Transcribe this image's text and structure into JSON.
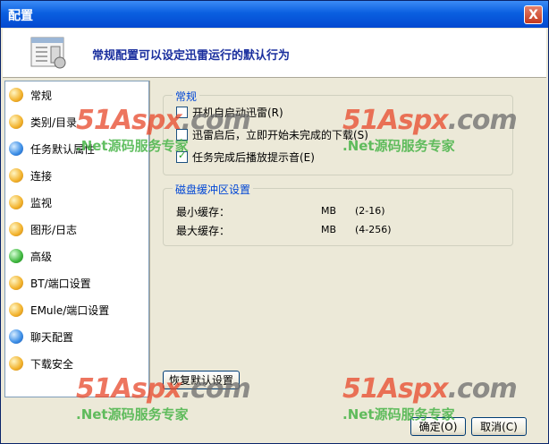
{
  "window": {
    "title": "配置",
    "close_glyph": "X"
  },
  "header": {
    "text": "常规配置可以设定迅雷运行的默认行为",
    "icon": "settings-document-icon"
  },
  "sidebar": {
    "items": [
      {
        "label": "常规",
        "icon": "orange-circle-icon"
      },
      {
        "label": "类别/目录",
        "icon": "orange-circle-icon"
      },
      {
        "label": "任务默认属性",
        "icon": "blue-star-icon"
      },
      {
        "label": "连接",
        "icon": "orange-circle-icon"
      },
      {
        "label": "监视",
        "icon": "orange-circle-icon"
      },
      {
        "label": "图形/日志",
        "icon": "orange-circle-icon"
      },
      {
        "label": "高级",
        "icon": "green-circle-icon"
      },
      {
        "label": "BT/端口设置",
        "icon": "orange-circle-icon"
      },
      {
        "label": "EMule/端口设置",
        "icon": "orange-circle-icon"
      },
      {
        "label": "聊天配置",
        "icon": "chat-icon"
      },
      {
        "label": "下载安全",
        "icon": "orange-circle-icon"
      }
    ]
  },
  "general": {
    "title": "常规",
    "options": [
      {
        "label": "开机自启动迅雷(R)",
        "checked": false
      },
      {
        "label": "迅雷启后，立即开始未完成的下载(S)",
        "checked": false
      },
      {
        "label": "任务完成后播放提示音(E)",
        "checked": true
      }
    ]
  },
  "cache": {
    "title": "磁盘缓冲区设置",
    "min_label": "最小缓存：",
    "min_unit": "MB",
    "min_range": "(2-16)",
    "max_label": "最大缓存：",
    "max_unit": "MB",
    "max_range": "(4-256)"
  },
  "buttons": {
    "restore": "恢复默认设置",
    "ok": "确定(O)",
    "cancel": "取消(C)"
  },
  "watermark": {
    "logo_main": "51",
    "logo_rest": "Aspx",
    "logo_tld": ".com",
    "sub": ".Net源码服务专家"
  },
  "colors": {
    "title_bar": "#0a5fe0",
    "header_text": "#1a2f9e",
    "group_title": "#0046d5",
    "watermark_red": "#e8482a",
    "watermark_green": "#47b447"
  }
}
